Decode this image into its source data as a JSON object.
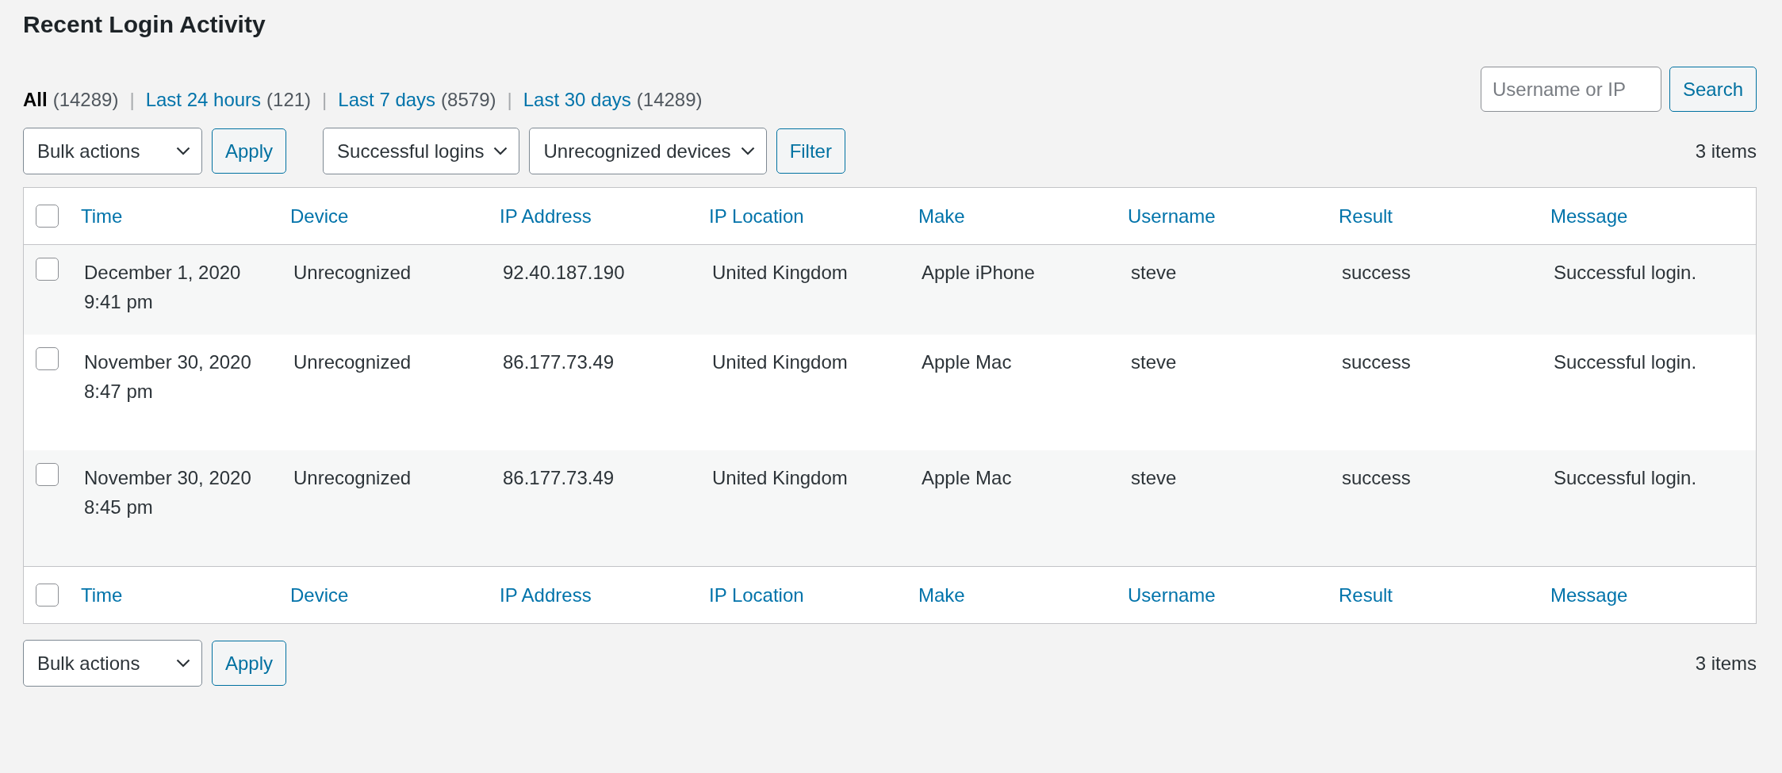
{
  "title": "Recent Login Activity",
  "views": [
    {
      "label": "All",
      "count": "(14289)",
      "selected": true
    },
    {
      "separator": "|",
      "label": "Last 24 hours",
      "count": "(121)",
      "selected": false
    },
    {
      "separator": "|",
      "label": "Last 7 days",
      "count": "(8579)",
      "selected": false
    },
    {
      "separator": "|",
      "label": "Last 30 days",
      "count": "(14289)",
      "selected": false
    }
  ],
  "search": {
    "placeholder": "Username or IP",
    "button": "Search"
  },
  "top_toolbar": {
    "bulk_actions": "Bulk actions",
    "apply": "Apply",
    "filters": [
      "Successful logins",
      "Unrecognized devices"
    ],
    "filter_button": "Filter",
    "count": "3 items"
  },
  "table": {
    "header_checked": false,
    "footer_checked": false,
    "columns": [
      "Time",
      "Device",
      "IP Address",
      "IP Location",
      "Make",
      "Username",
      "Result",
      "Message"
    ],
    "rows": [
      {
        "checked": false,
        "cells": [
          "December 1, 2020\n9:41 pm",
          "Unrecognized",
          "92.40.187.190",
          "United Kingdom",
          "Apple iPhone",
          "steve",
          "success",
          "Successful login."
        ]
      },
      {
        "checked": false,
        "cells": [
          "November 30, 2020\n8:47 pm",
          "Unrecognized",
          "86.177.73.49",
          "United Kingdom",
          "Apple Mac",
          "steve",
          "success",
          "Successful login."
        ]
      },
      {
        "checked": false,
        "cells": [
          "November 30, 2020\n8:45 pm",
          "Unrecognized",
          "86.177.73.49",
          "United Kingdom",
          "Apple Mac",
          "steve",
          "success",
          "Successful login."
        ]
      }
    ],
    "footer_columns": [
      "Time",
      "Device",
      "IP Address",
      "IP Location",
      "Make",
      "Username",
      "Result",
      "Message"
    ]
  },
  "bottom_toolbar": {
    "bulk_actions": "Bulk actions",
    "apply": "Apply",
    "count": "3 items"
  }
}
